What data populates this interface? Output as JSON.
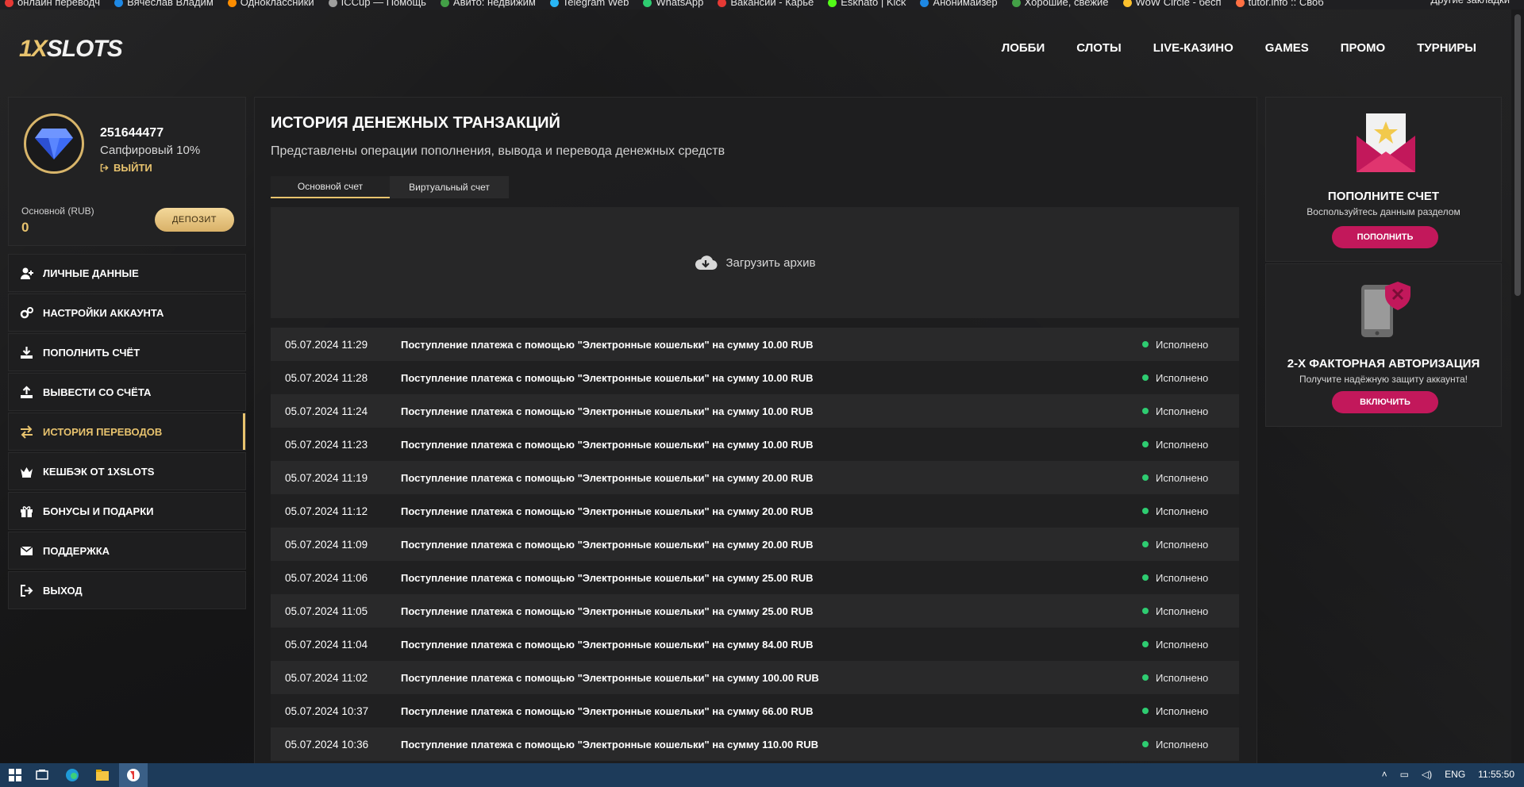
{
  "bookmarks": {
    "items": [
      {
        "label": "онлайн переводч",
        "color": "#e53935"
      },
      {
        "label": "Вячеслав Владим",
        "color": "#1e88e5"
      },
      {
        "label": "Одноклассники",
        "color": "#fb8c00"
      },
      {
        "label": "ICCup — Помощь",
        "color": "#9e9e9e"
      },
      {
        "label": "Авито: недвижим",
        "color": "#43a047"
      },
      {
        "label": "Telegram Web",
        "color": "#29b6f6"
      },
      {
        "label": "WhatsApp",
        "color": "#2ecc71"
      },
      {
        "label": "Вакансии - Карье",
        "color": "#e53935"
      },
      {
        "label": "Eskhato | Kick",
        "color": "#53fc18"
      },
      {
        "label": "Анонимайзер",
        "color": "#1e88e5"
      },
      {
        "label": "Хорошие, свежие",
        "color": "#43a047"
      },
      {
        "label": "WoW Circle - бесп",
        "color": "#fbc02d"
      },
      {
        "label": "tutor.info :: Своб",
        "color": "#ff7043"
      }
    ],
    "more_label": "Другие закладки"
  },
  "header": {
    "logo_prefix": "1X",
    "logo_suffix": "SLOTS",
    "nav": [
      "ЛОББИ",
      "СЛОТЫ",
      "LIVE-КАЗИНО",
      "GAMES",
      "ПРОМО",
      "ТУРНИРЫ"
    ]
  },
  "profile": {
    "user_id": "251644477",
    "level": "Сапфировый 10%",
    "logout_label": "ВЫЙТИ",
    "account_label": "Основной (RUB)",
    "account_value": "0",
    "deposit_label": "ДЕПОЗИТ"
  },
  "menu": [
    {
      "label": "ЛИЧНЫЕ ДАННЫЕ",
      "icon": "user-plus-icon",
      "active": false
    },
    {
      "label": "НАСТРОЙКИ АККАУНТА",
      "icon": "gears-icon",
      "active": false
    },
    {
      "label": "ПОПОЛНИТЬ СЧЁТ",
      "icon": "download-icon",
      "active": false
    },
    {
      "label": "ВЫВЕСТИ СО СЧЁТА",
      "icon": "upload-icon",
      "active": false
    },
    {
      "label": "ИСТОРИЯ ПЕРЕВОДОВ",
      "icon": "exchange-icon",
      "active": true
    },
    {
      "label": "КЕШБЭК ОТ 1XSLOTS",
      "icon": "crown-icon",
      "active": false
    },
    {
      "label": "БОНУСЫ И ПОДАРКИ",
      "icon": "gift-icon",
      "active": false
    },
    {
      "label": "ПОДДЕРЖКА",
      "icon": "envelope-icon",
      "active": false
    },
    {
      "label": "ВЫХОД",
      "icon": "sign-out-icon",
      "active": false
    }
  ],
  "main": {
    "title": "ИСТОРИЯ ДЕНЕЖНЫХ ТРАНЗАКЦИЙ",
    "subtitle": "Представлены операции пополнения, вывода и перевода денежных средств",
    "tabs": [
      "Основной счет",
      "Виртуальный счет"
    ],
    "archive_label": "Загрузить архив",
    "transactions": [
      {
        "date": "05.07.2024 11:29",
        "desc": "Поступление платежа с помощью \"Электронные кошельки\" на сумму 10.00 RUB",
        "status": "Исполнено"
      },
      {
        "date": "05.07.2024 11:28",
        "desc": "Поступление платежа с помощью \"Электронные кошельки\" на сумму 10.00 RUB",
        "status": "Исполнено"
      },
      {
        "date": "05.07.2024 11:24",
        "desc": "Поступление платежа с помощью \"Электронные кошельки\" на сумму 10.00 RUB",
        "status": "Исполнено"
      },
      {
        "date": "05.07.2024 11:23",
        "desc": "Поступление платежа с помощью \"Электронные кошельки\" на сумму 10.00 RUB",
        "status": "Исполнено"
      },
      {
        "date": "05.07.2024 11:19",
        "desc": "Поступление платежа с помощью \"Электронные кошельки\" на сумму 20.00 RUB",
        "status": "Исполнено"
      },
      {
        "date": "05.07.2024 11:12",
        "desc": "Поступление платежа с помощью \"Электронные кошельки\" на сумму 20.00 RUB",
        "status": "Исполнено"
      },
      {
        "date": "05.07.2024 11:09",
        "desc": "Поступление платежа с помощью \"Электронные кошельки\" на сумму 20.00 RUB",
        "status": "Исполнено"
      },
      {
        "date": "05.07.2024 11:06",
        "desc": "Поступление платежа с помощью \"Электронные кошельки\" на сумму 25.00 RUB",
        "status": "Исполнено"
      },
      {
        "date": "05.07.2024 11:05",
        "desc": "Поступление платежа с помощью \"Электронные кошельки\" на сумму 25.00 RUB",
        "status": "Исполнено"
      },
      {
        "date": "05.07.2024 11:04",
        "desc": "Поступление платежа с помощью \"Электронные кошельки\" на сумму 84.00 RUB",
        "status": "Исполнено"
      },
      {
        "date": "05.07.2024 11:02",
        "desc": "Поступление платежа с помощью \"Электронные кошельки\" на сумму 100.00 RUB",
        "status": "Исполнено"
      },
      {
        "date": "05.07.2024 10:37",
        "desc": "Поступление платежа с помощью \"Электронные кошельки\" на сумму 66.00 RUB",
        "status": "Исполнено"
      },
      {
        "date": "05.07.2024 10:36",
        "desc": "Поступление платежа с помощью \"Электронные кошельки\" на сумму 110.00 RUB",
        "status": "Исполнено"
      }
    ]
  },
  "promos": [
    {
      "title": "ПОПОЛНИТЕ СЧЕТ",
      "text": "Воспользуйтесь данным разделом",
      "button": "ПОПОЛНИТЬ",
      "icon": "envelope-star-icon"
    },
    {
      "title": "2-Х ФАКТОРНАЯ АВТОРИЗАЦИЯ",
      "text": "Получите надёжную защиту аккаунта!",
      "button": "ВКЛЮЧИТЬ",
      "icon": "phone-shield-icon"
    }
  ],
  "taskbar": {
    "lang": "ENG",
    "time": "11:55:50"
  },
  "colors": {
    "accent": "#e8c36e",
    "promo_button": "#c2185b",
    "status_ok": "#2ecc71"
  }
}
